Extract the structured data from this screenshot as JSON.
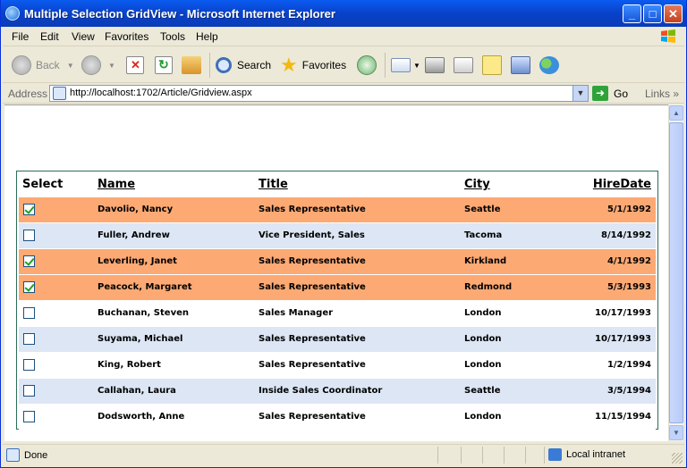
{
  "window": {
    "title": "Multiple Selection GridView - Microsoft Internet Explorer",
    "buttons": {
      "minimize": "_",
      "maximize": "□",
      "close": "✕"
    }
  },
  "menu": {
    "items": [
      "File",
      "Edit",
      "View",
      "Favorites",
      "Tools",
      "Help"
    ]
  },
  "toolbar": {
    "back_label": "Back",
    "search_label": "Search",
    "favorites_label": "Favorites",
    "icons": [
      "back-arrow-icon",
      "forward-arrow-icon",
      "stop-icon",
      "refresh-icon",
      "home-icon",
      "search-icon",
      "favorites-star-icon",
      "history-icon",
      "mail-icon",
      "print-icon",
      "edit-icon",
      "discuss-icon",
      "research-icon",
      "messenger-icon"
    ]
  },
  "address": {
    "label": "Address",
    "url": "http://localhost:1702/Article/Gridview.aspx",
    "go_label": "Go",
    "links_label": "Links",
    "links_chevron": "»"
  },
  "grid": {
    "columns": [
      "Select",
      "Name",
      "Title",
      "City",
      "HireDate"
    ],
    "rows": [
      {
        "checked": true,
        "name": "Davolio, Nancy",
        "title": "Sales Representative",
        "city": "Seattle",
        "hire_date": "5/1/1992",
        "style": "sel"
      },
      {
        "checked": false,
        "name": "Fuller, Andrew",
        "title": "Vice President, Sales",
        "city": "Tacoma",
        "hire_date": "8/14/1992",
        "style": "alt"
      },
      {
        "checked": true,
        "name": "Leverling, Janet",
        "title": "Sales Representative",
        "city": "Kirkland",
        "hire_date": "4/1/1992",
        "style": "sel"
      },
      {
        "checked": true,
        "name": "Peacock, Margaret",
        "title": "Sales Representative",
        "city": "Redmond",
        "hire_date": "5/3/1993",
        "style": "sel"
      },
      {
        "checked": false,
        "name": "Buchanan, Steven",
        "title": "Sales Manager",
        "city": "London",
        "hire_date": "10/17/1993",
        "style": "norm"
      },
      {
        "checked": false,
        "name": "Suyama, Michael",
        "title": "Sales Representative",
        "city": "London",
        "hire_date": "10/17/1993",
        "style": "alt"
      },
      {
        "checked": false,
        "name": "King, Robert",
        "title": "Sales Representative",
        "city": "London",
        "hire_date": "1/2/1994",
        "style": "norm"
      },
      {
        "checked": false,
        "name": "Callahan, Laura",
        "title": "Inside Sales Coordinator",
        "city": "Seattle",
        "hire_date": "3/5/1994",
        "style": "alt"
      },
      {
        "checked": false,
        "name": "Dodsworth, Anne",
        "title": "Sales Representative",
        "city": "London",
        "hire_date": "11/15/1994",
        "style": "norm"
      }
    ]
  },
  "status": {
    "text": "Done",
    "zone": "Local intranet"
  },
  "colors": {
    "selected_row": "#fda974",
    "alt_row": "#dce6f5",
    "title_bar": "#0842c9"
  }
}
